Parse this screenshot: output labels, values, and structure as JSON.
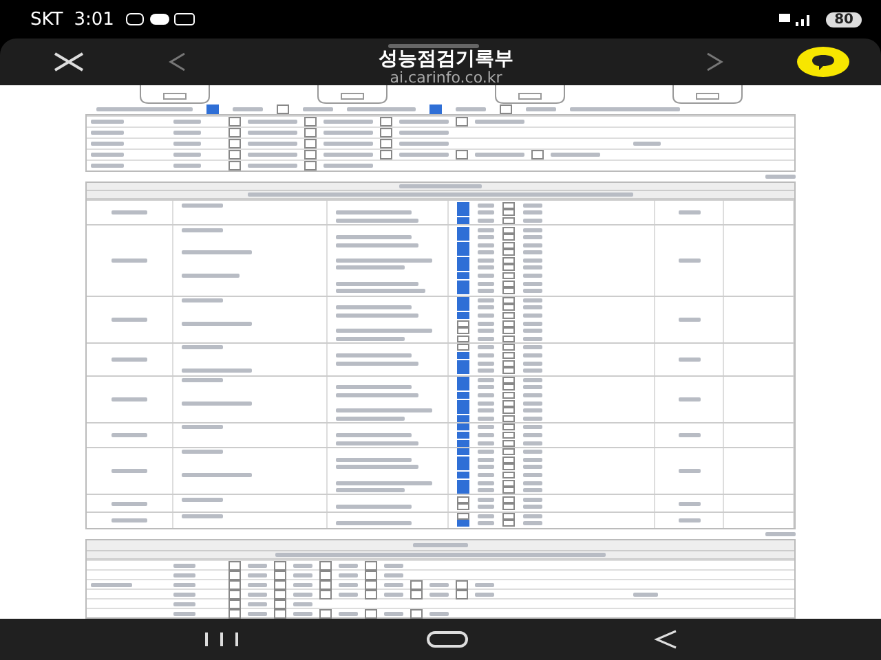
{
  "status_bar": {
    "carrier": "SKT",
    "time": "3:01",
    "battery": "80"
  },
  "browser": {
    "title": "성능점검기록부",
    "url": "ai.carinfo.co.kr"
  },
  "document": {
    "top_flags": [
      {
        "checked": true
      },
      {
        "checked": false
      },
      {
        "checked": true
      },
      {
        "checked": false
      }
    ],
    "top_rows": [
      [
        false,
        false,
        false,
        false
      ],
      [
        false,
        false,
        false
      ],
      [
        false,
        false,
        false
      ],
      [
        false,
        false,
        false,
        false,
        false
      ],
      [
        false,
        false
      ]
    ],
    "detail_groups": [
      {
        "rows": [
          {
            "checked": true,
            "checked_2": false
          },
          {
            "checked": true,
            "checked_2": false
          },
          {
            "checked": true,
            "checked_2": false
          }
        ]
      },
      {
        "rows": [
          {
            "checked": true,
            "checked_2": false
          },
          {
            "checked": true,
            "checked_2": false
          },
          {
            "checked": true,
            "checked_2": false
          },
          {
            "checked": true,
            "checked_2": false
          },
          {
            "checked": true,
            "checked_2": false
          },
          {
            "checked": true,
            "checked_2": false
          },
          {
            "checked": true,
            "checked_2": false
          },
          {
            "checked": true,
            "checked_2": false
          },
          {
            "checked": true,
            "checked_2": false
          }
        ]
      },
      {
        "rows": [
          {
            "checked": true,
            "checked_2": false
          },
          {
            "checked": true,
            "checked_2": false
          },
          {
            "checked": true,
            "checked_2": false
          },
          {
            "checked": false,
            "checked_2": false
          },
          {
            "checked": false,
            "checked_2": false
          },
          {
            "checked": false,
            "checked_2": false
          }
        ]
      },
      {
        "rows": [
          {
            "checked": false,
            "checked_2": false
          },
          {
            "checked": true,
            "checked_2": false
          },
          {
            "checked": true,
            "checked_2": false
          },
          {
            "checked": true,
            "checked_2": false
          }
        ]
      },
      {
        "rows": [
          {
            "checked": true,
            "checked_2": false
          },
          {
            "checked": true,
            "checked_2": false
          },
          {
            "checked": true,
            "checked_2": false
          },
          {
            "checked": true,
            "checked_2": false
          },
          {
            "checked": true,
            "checked_2": false
          },
          {
            "checked": true,
            "checked_2": false
          }
        ]
      },
      {
        "rows": [
          {
            "checked": true,
            "checked_2": false
          },
          {
            "checked": true,
            "checked_2": false
          },
          {
            "checked": true,
            "checked_2": false
          }
        ]
      },
      {
        "rows": [
          {
            "checked": true,
            "checked_2": false
          },
          {
            "checked": true,
            "checked_2": false
          },
          {
            "checked": true,
            "checked_2": false
          },
          {
            "checked": true,
            "checked_2": false
          },
          {
            "checked": true,
            "checked_2": false
          },
          {
            "checked": true,
            "checked_2": false
          }
        ]
      },
      {
        "rows": [
          {
            "checked": false,
            "checked_2": false
          },
          {
            "checked": false,
            "checked_2": false
          }
        ]
      },
      {
        "rows": [
          {
            "checked": false,
            "checked_2": false
          },
          {
            "checked": true,
            "checked_2": false
          }
        ]
      }
    ],
    "bottom_rows": [
      [
        false,
        false,
        false,
        false
      ],
      [
        false,
        false,
        false,
        false
      ],
      [
        false,
        false,
        false,
        false,
        false,
        false
      ],
      [
        false,
        false,
        false,
        false,
        false,
        false
      ],
      [
        false,
        false
      ],
      [
        false,
        false,
        false,
        false,
        false
      ]
    ]
  }
}
